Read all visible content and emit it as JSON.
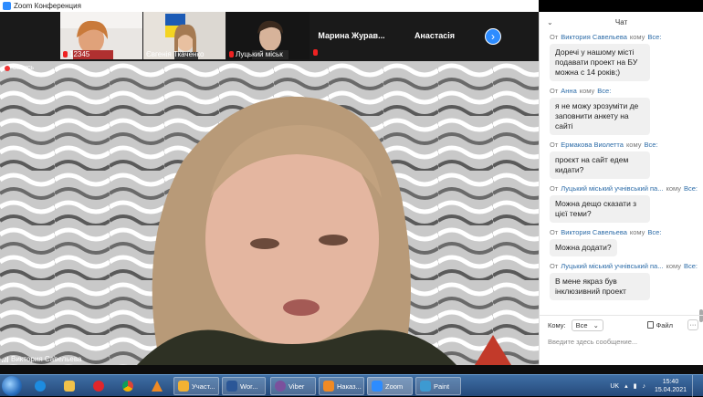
{
  "window": {
    "title": "Zoom Конференция",
    "minimize": "—",
    "maximize": "☐",
    "close": "✕"
  },
  "thumbnails": [
    {
      "name": "12345",
      "muted": true
    },
    {
      "name": "Євгенія Ткаченко",
      "muted": false
    },
    {
      "name": "Луцький міськ",
      "muted": true
    },
    {
      "name": "Марина  Журав...",
      "muted": true
    },
    {
      "name": "Анастасія",
      "muted": false
    }
  ],
  "next_page_glyph": "›",
  "main_video": {
    "recording_label": "Запись",
    "speaker": "Виктория Савельева"
  },
  "chat": {
    "title": "Чат",
    "from_word": "От",
    "to_word": "кому",
    "messages": [
      {
        "sender": "Виктория Савельева",
        "to": "Все:",
        "text": "Доречі у нашому місті подавати проект на БУ можна с 14 років;)",
        "more": false
      },
      {
        "sender": "Анна",
        "to": "Все:",
        "text": "я не можу зрозуміти де заповнити анкету на сайті",
        "more": false
      },
      {
        "sender": "Ермакова Виолетта",
        "to": "Все:",
        "text": "проєкт на сайт едем кидати?",
        "more": false
      },
      {
        "sender": "Луцький міський учнівський па...",
        "to": "Все:",
        "text": "Можна дещо сказати з цієї теми?",
        "more": true
      },
      {
        "sender": "Виктория Савельева",
        "to": "Все:",
        "text": "Можна додати?",
        "more": false
      },
      {
        "sender": "Луцький міський учнівський па...",
        "to": "Все:",
        "text": "В мене якраз був інклюзивний проект",
        "more": true
      }
    ],
    "more_glyph": "···",
    "footer": {
      "to_label": "Кому:",
      "recipient": "Все",
      "file_label": "Файл",
      "more_label": "···",
      "input_placeholder": "Введите здесь сообщение..."
    }
  },
  "taskbar": {
    "tasks": [
      {
        "label": "Участ...",
        "color": "#f2b233"
      },
      {
        "label": "Wor...",
        "color": "#2b5797"
      },
      {
        "label": "Viber",
        "color": "#7b519d"
      },
      {
        "label": "Наказ...",
        "color": "#f08a24"
      },
      {
        "label": "Zoom",
        "color": "#2d8cff"
      },
      {
        "label": "Paint",
        "color": "#3d9ad1"
      }
    ],
    "lang": "UK",
    "time": "15:40",
    "date": "15.04.2021"
  }
}
